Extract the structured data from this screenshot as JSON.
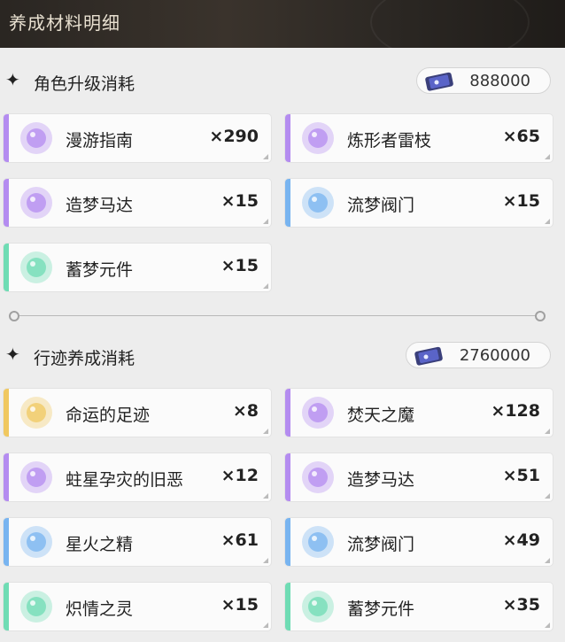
{
  "header": {
    "title": "养成材料明细"
  },
  "colors": {
    "purple": "#b48cf0",
    "blue": "#78b4f0",
    "green": "#6fdcb4",
    "gold": "#f0c860"
  },
  "sections": [
    {
      "label": "角色升级消耗",
      "currency": "888000",
      "items": [
        {
          "name": "漫游指南",
          "qty": "×290",
          "rarity": "purple",
          "icon": "book-icon"
        },
        {
          "name": "炼形者雷枝",
          "qty": "×65",
          "rarity": "purple",
          "icon": "lightning-branch-icon"
        },
        {
          "name": "造梦马达",
          "qty": "×15",
          "rarity": "purple",
          "icon": "dream-motor-icon"
        },
        {
          "name": "流梦阀门",
          "qty": "×15",
          "rarity": "blue",
          "icon": "dream-valve-icon"
        },
        {
          "name": "蓄梦元件",
          "qty": "×15",
          "rarity": "green",
          "icon": "dream-component-icon"
        }
      ]
    },
    {
      "label": "行迹养成消耗",
      "currency": "2760000",
      "items": [
        {
          "name": "命运的足迹",
          "qty": "×8",
          "rarity": "gold",
          "icon": "footprint-icon"
        },
        {
          "name": "焚天之魔",
          "qty": "×128",
          "rarity": "purple",
          "icon": "blue-flame-demon-icon"
        },
        {
          "name": "蛀星孕灾的旧恶",
          "qty": "×12",
          "rarity": "purple",
          "icon": "ancient-evil-icon"
        },
        {
          "name": "造梦马达",
          "qty": "×51",
          "rarity": "purple",
          "icon": "dream-motor-icon"
        },
        {
          "name": "星火之精",
          "qty": "×61",
          "rarity": "blue",
          "icon": "starfire-essence-icon"
        },
        {
          "name": "流梦阀门",
          "qty": "×49",
          "rarity": "blue",
          "icon": "dream-valve-icon"
        },
        {
          "name": "炽情之灵",
          "qty": "×15",
          "rarity": "green",
          "icon": "passion-spirit-icon"
        },
        {
          "name": "蓄梦元件",
          "qty": "×35",
          "rarity": "green",
          "icon": "dream-component-icon"
        }
      ]
    }
  ]
}
